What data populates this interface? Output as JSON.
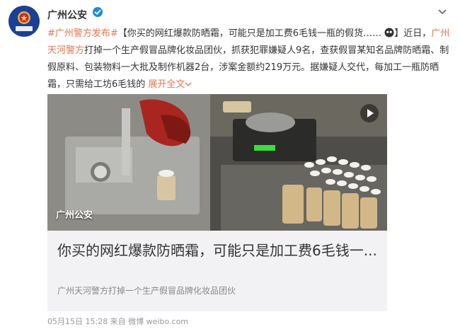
{
  "account": {
    "name": "广州公安",
    "avatar_label": "广州公安"
  },
  "post": {
    "hashtag": "#广州警方发布#",
    "headline": "【你买的网红爆款防晒霜，可能只是加工费6毛钱一瓶的假货……",
    "headline_end": "】近日，",
    "mention": "广州天河警方",
    "body": "打掉一个生产假冒品牌化妆品团伙，抓获犯罪嫌疑人9名，查获假冒某知名品牌防晒霜、制假原料、包装物料一大批及制作机器2台，涉案金额约219万元。据嫌疑人交代，每加工一瓶防晒霜，只需给工坊6毛钱的",
    "expand_label": "展开全文",
    "media_caption": "广州公安"
  },
  "card": {
    "title": "你买的网红爆款防晒霜，可能只是加工费6毛钱一...",
    "subtitle": "广州天河警方打掉一个生产假冒品牌化妆品团伙"
  },
  "footer": {
    "meta": "05月15日 15:28 来自 微博 weibo.com"
  },
  "colors": {
    "accent": "#eb7350",
    "brand_blue": "#1c3f95",
    "verified": "#f7b500"
  }
}
